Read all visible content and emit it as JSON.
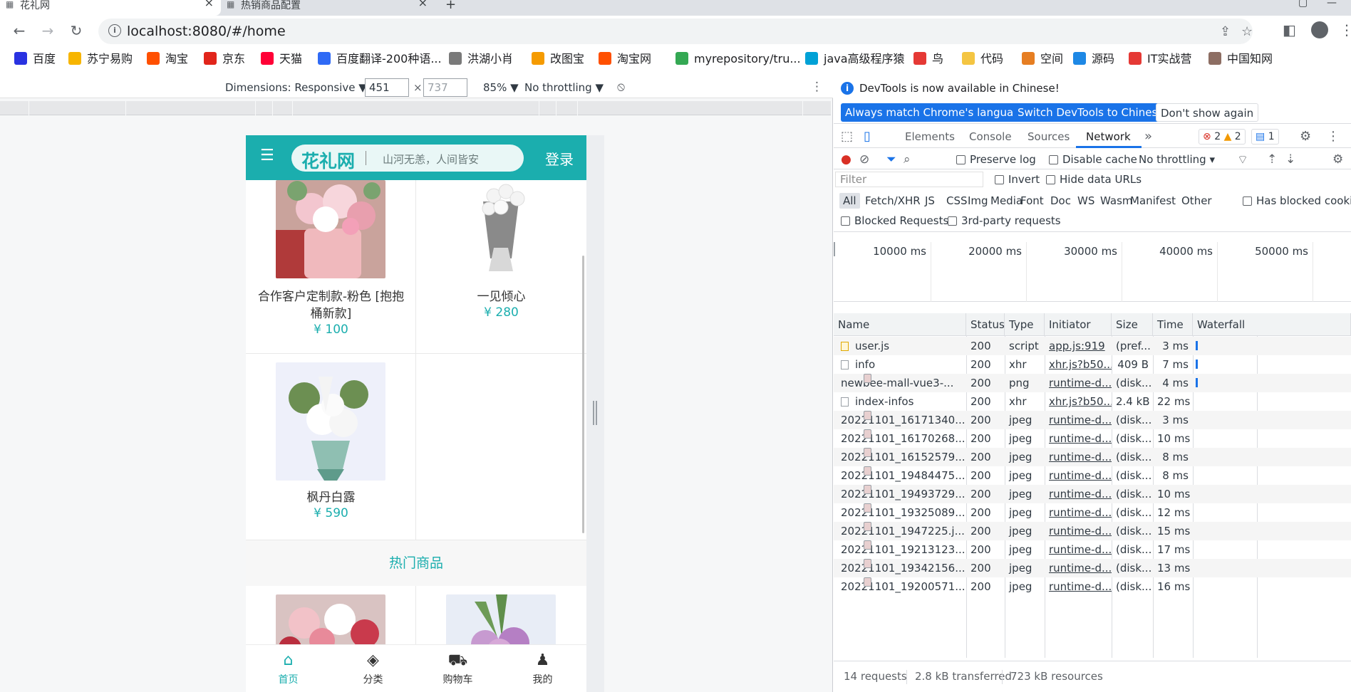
{
  "browser": {
    "tabs": [
      {
        "title": "花礼网"
      },
      {
        "title": "热销商品配置"
      }
    ],
    "url": "localhost:8080/#/home",
    "bookmarks": [
      {
        "label": "百度",
        "color": "#2932e1"
      },
      {
        "label": "苏宁易购",
        "color": "#f7b500"
      },
      {
        "label": "淘宝",
        "color": "#ff5000"
      },
      {
        "label": "京东",
        "color": "#e1251b"
      },
      {
        "label": "天猫",
        "color": "#ff0036"
      },
      {
        "label": "百度翻译-200种语...",
        "color": "#2f6af5"
      },
      {
        "label": "洪湖小肖",
        "color": "#7a7a7a"
      },
      {
        "label": "改图宝",
        "color": "#f59b00"
      },
      {
        "label": "淘宝网",
        "color": "#ff5000"
      },
      {
        "label": "myrepository/tru...",
        "color": "#34a853"
      },
      {
        "label": "java高级程序猿",
        "color": "#00a1d6"
      },
      {
        "label": "鸟",
        "color": "#e53935"
      },
      {
        "label": "代码",
        "color": "#f4c542"
      },
      {
        "label": "空间",
        "color": "#e67e22"
      },
      {
        "label": "源码",
        "color": "#1e88e5"
      },
      {
        "label": "IT实战营",
        "color": "#e53935"
      },
      {
        "label": "中国知网",
        "color": "#8d6e63"
      }
    ]
  },
  "device_toolbar": {
    "dimensions_label": "Dimensions: Responsive ▼",
    "width": "451",
    "height_placeholder": "737",
    "times": "×",
    "zoom": "85% ▼",
    "throttling": "No throttling ▼"
  },
  "app": {
    "brand": "花礼网",
    "slogan": "山河无恙，人间皆安",
    "login": "登录",
    "goods": [
      {
        "name": "合作客户定制款-粉色 [抱抱桶新款]",
        "price": "¥ 100"
      },
      {
        "name": "一见倾心",
        "price": "¥ 280"
      },
      {
        "name": "枫丹白露",
        "price": "¥ 590"
      }
    ],
    "section_title": "热门商品",
    "tabbar": [
      {
        "label": "首页"
      },
      {
        "label": "分类"
      },
      {
        "label": "购物车"
      },
      {
        "label": "我的"
      }
    ]
  },
  "devtools": {
    "info_message": "DevTools is now available in Chinese!",
    "btn_match": "Always match Chrome's language",
    "btn_switch": "Switch DevTools to Chinese",
    "btn_dismiss": "Don't show again",
    "panel_tabs": [
      "Elements",
      "Console",
      "Sources",
      "Network"
    ],
    "errors": "2",
    "warnings": "2",
    "messages": "1",
    "preserve_log": "Preserve log",
    "disable_cache": "Disable cache",
    "throttling": "No throttling",
    "filter_placeholder": "Filter",
    "invert": "Invert",
    "hide_data_urls": "Hide data URLs",
    "types": [
      "All",
      "Fetch/XHR",
      "JS",
      "CSS",
      "Img",
      "Media",
      "Font",
      "Doc",
      "WS",
      "Wasm",
      "Manifest",
      "Other"
    ],
    "has_blocked_cookies": "Has blocked cookie",
    "blocked_requests": "Blocked Requests",
    "third_party": "3rd-party requests",
    "timeline_labels": [
      "10000 ms",
      "20000 ms",
      "30000 ms",
      "40000 ms",
      "50000 ms"
    ],
    "columns": [
      "Name",
      "Status",
      "Type",
      "Initiator",
      "Size",
      "Time",
      "Waterfall"
    ],
    "requests": [
      {
        "name": "user.js",
        "status": "200",
        "type": "script",
        "initiator": "app.js:919",
        "size": "(pref...",
        "time": "3 ms",
        "icon": "js"
      },
      {
        "name": "info",
        "status": "200",
        "type": "xhr",
        "initiator": "xhr.js?b50...",
        "size": "409 B",
        "time": "7 ms",
        "icon": "doc"
      },
      {
        "name": "newbee-mall-vue3-...",
        "status": "200",
        "type": "png",
        "initiator": "runtime-d...",
        "size": "(disk...",
        "time": "4 ms",
        "icon": "img"
      },
      {
        "name": "index-infos",
        "status": "200",
        "type": "xhr",
        "initiator": "xhr.js?b50...",
        "size": "2.4 kB",
        "time": "22 ms",
        "icon": "doc"
      },
      {
        "name": "20221101_16171340...",
        "status": "200",
        "type": "jpeg",
        "initiator": "runtime-d...",
        "size": "(disk...",
        "time": "3 ms",
        "icon": "img"
      },
      {
        "name": "20221101_16170268...",
        "status": "200",
        "type": "jpeg",
        "initiator": "runtime-d...",
        "size": "(disk...",
        "time": "10 ms",
        "icon": "img"
      },
      {
        "name": "20221101_16152579...",
        "status": "200",
        "type": "jpeg",
        "initiator": "runtime-d...",
        "size": "(disk...",
        "time": "8 ms",
        "icon": "img"
      },
      {
        "name": "20221101_19484475...",
        "status": "200",
        "type": "jpeg",
        "initiator": "runtime-d...",
        "size": "(disk...",
        "time": "8 ms",
        "icon": "img"
      },
      {
        "name": "20221101_19493729...",
        "status": "200",
        "type": "jpeg",
        "initiator": "runtime-d...",
        "size": "(disk...",
        "time": "10 ms",
        "icon": "img"
      },
      {
        "name": "20221101_19325089...",
        "status": "200",
        "type": "jpeg",
        "initiator": "runtime-d...",
        "size": "(disk...",
        "time": "12 ms",
        "icon": "img"
      },
      {
        "name": "20221101_1947225.j...",
        "status": "200",
        "type": "jpeg",
        "initiator": "runtime-d...",
        "size": "(disk...",
        "time": "15 ms",
        "icon": "img"
      },
      {
        "name": "20221101_19213123...",
        "status": "200",
        "type": "jpeg",
        "initiator": "runtime-d...",
        "size": "(disk...",
        "time": "17 ms",
        "icon": "img"
      },
      {
        "name": "20221101_19342156...",
        "status": "200",
        "type": "jpeg",
        "initiator": "runtime-d...",
        "size": "(disk...",
        "time": "13 ms",
        "icon": "img"
      },
      {
        "name": "20221101_19200571...",
        "status": "200",
        "type": "jpeg",
        "initiator": "runtime-d...",
        "size": "(disk...",
        "time": "16 ms",
        "icon": "img"
      }
    ],
    "summary_requests": "14 requests",
    "summary_transferred": "2.8 kB transferred",
    "summary_resources": "723 kB resources"
  }
}
